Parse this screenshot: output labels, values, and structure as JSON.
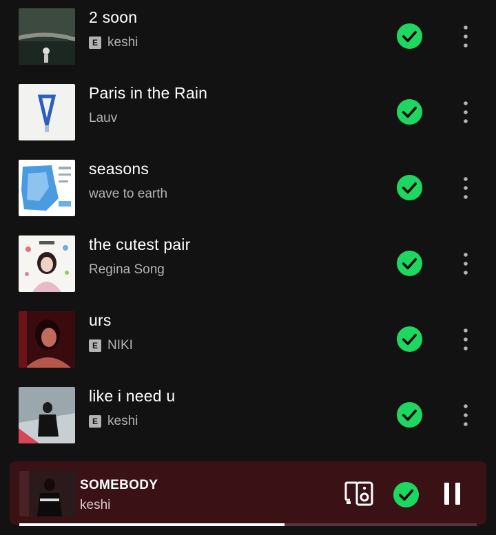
{
  "tracks": [
    {
      "title": "2 soon",
      "artist": "keshi",
      "explicit": true,
      "art_icon": "album-art-2soon"
    },
    {
      "title": "Paris in the Rain",
      "artist": "Lauv",
      "explicit": false,
      "art_icon": "album-art-paris"
    },
    {
      "title": "seasons",
      "artist": "wave to earth",
      "explicit": false,
      "art_icon": "album-art-seasons"
    },
    {
      "title": "the cutest pair",
      "artist": "Regina Song",
      "explicit": false,
      "art_icon": "album-art-cutest-pair"
    },
    {
      "title": "urs",
      "artist": "NIKI",
      "explicit": true,
      "art_icon": "album-art-urs"
    },
    {
      "title": "like i need u",
      "artist": "keshi",
      "explicit": true,
      "art_icon": "album-art-like-i-need-u"
    }
  ],
  "explicit_badge": "E",
  "now_playing": {
    "title": "SOMEBODY",
    "artist": "keshi",
    "progress": 0.58
  },
  "colors": {
    "accent": "#1ed760",
    "background": "#121212",
    "player_bg": "#3a1216"
  }
}
